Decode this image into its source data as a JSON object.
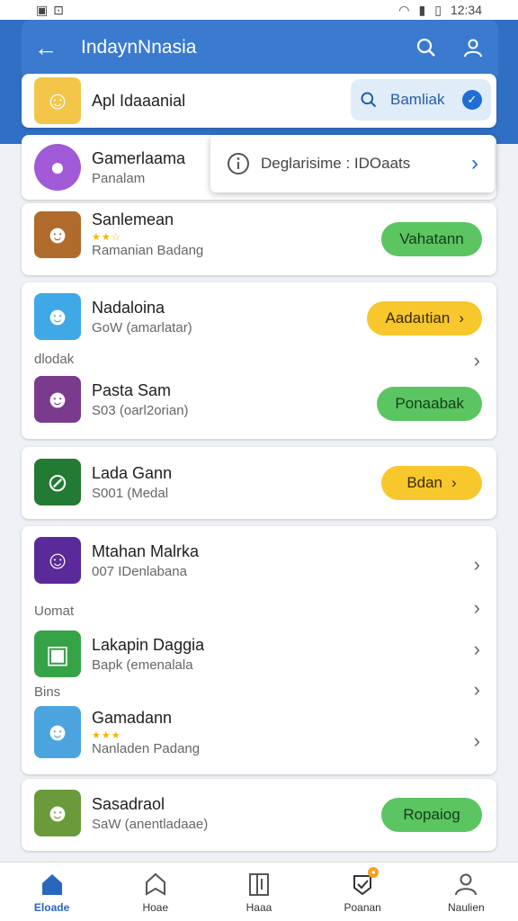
{
  "status_bar": {
    "time": "12:34"
  },
  "app_bar": {
    "title": "IndaynNnasia"
  },
  "search": {
    "label": "Apl Idaaanial",
    "button_label": "Bamliak"
  },
  "popup": {
    "text": "Deglarisime : IDOaats"
  },
  "featured": {
    "name": "Gamerlaama",
    "sub": "Panalam"
  },
  "apps": [
    {
      "name": "Sanlemean",
      "stars": "★★☆",
      "sub": "Ramanian Badang",
      "action": "Vahatann",
      "action_color": "green"
    },
    {
      "name": "Nadaloina",
      "sub": "GoW (amarlatar)",
      "action": "Aadaıtian",
      "action_color": "yellow"
    },
    {
      "name": "Pasta Sam",
      "sub": "S03 (oarl2orian)",
      "action": "Ponaabak",
      "action_color": "green"
    },
    {
      "name": "Lada Gann",
      "sub": "S001 (Medal",
      "action": "Bdan",
      "action_color": "yellow"
    },
    {
      "name": "Mtahan Malrka",
      "sub": "007 IDenlabana"
    },
    {
      "name": "Lakapin Daggia",
      "sub": "Bapk (emenalala"
    },
    {
      "name": "Gamadann",
      "stars": "★★★",
      "sub": "Nanladen Padang"
    },
    {
      "name": "Sasadraol",
      "sub": "SaW (anentladaae)",
      "action": "Ropaiog",
      "action_color": "green"
    }
  ],
  "section_labels": [
    "dlodak",
    "Uomat",
    "Bins"
  ],
  "bottom_nav": [
    {
      "label": "Eloade",
      "icon": "home-icon",
      "active": true
    },
    {
      "label": "Hoae",
      "icon": "bookmark-icon",
      "active": false
    },
    {
      "label": "Haaa",
      "icon": "library-icon",
      "active": false
    },
    {
      "label": "Poanan",
      "icon": "badge-icon",
      "active": false
    },
    {
      "label": "Naulien",
      "icon": "profile-icon",
      "active": false
    }
  ],
  "colors": {
    "primary": "#3a7bd0",
    "green": "#5bc561",
    "yellow": "#f7c72c"
  }
}
